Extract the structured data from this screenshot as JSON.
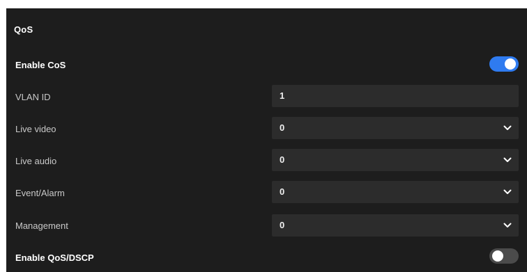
{
  "qos": {
    "title": "QoS",
    "enable_cos": {
      "label": "Enable CoS",
      "enabled": true
    },
    "vlan_id": {
      "label": "VLAN ID",
      "value": "1"
    },
    "live_video": {
      "label": "Live video",
      "value": "0"
    },
    "live_audio": {
      "label": "Live audio",
      "value": "0"
    },
    "event_alarm": {
      "label": "Event/Alarm",
      "value": "0"
    },
    "management": {
      "label": "Management",
      "value": "0"
    },
    "enable_qos_dscp": {
      "label": "Enable QoS/DSCP",
      "enabled": false
    }
  },
  "colors": {
    "panel_bg": "#1d1d1d",
    "field_bg": "#2c2c2c",
    "toggle_on": "#2f7bf0",
    "toggle_off": "#4b4b4b"
  },
  "icons": {
    "dropdown": "chevron-down-icon"
  }
}
